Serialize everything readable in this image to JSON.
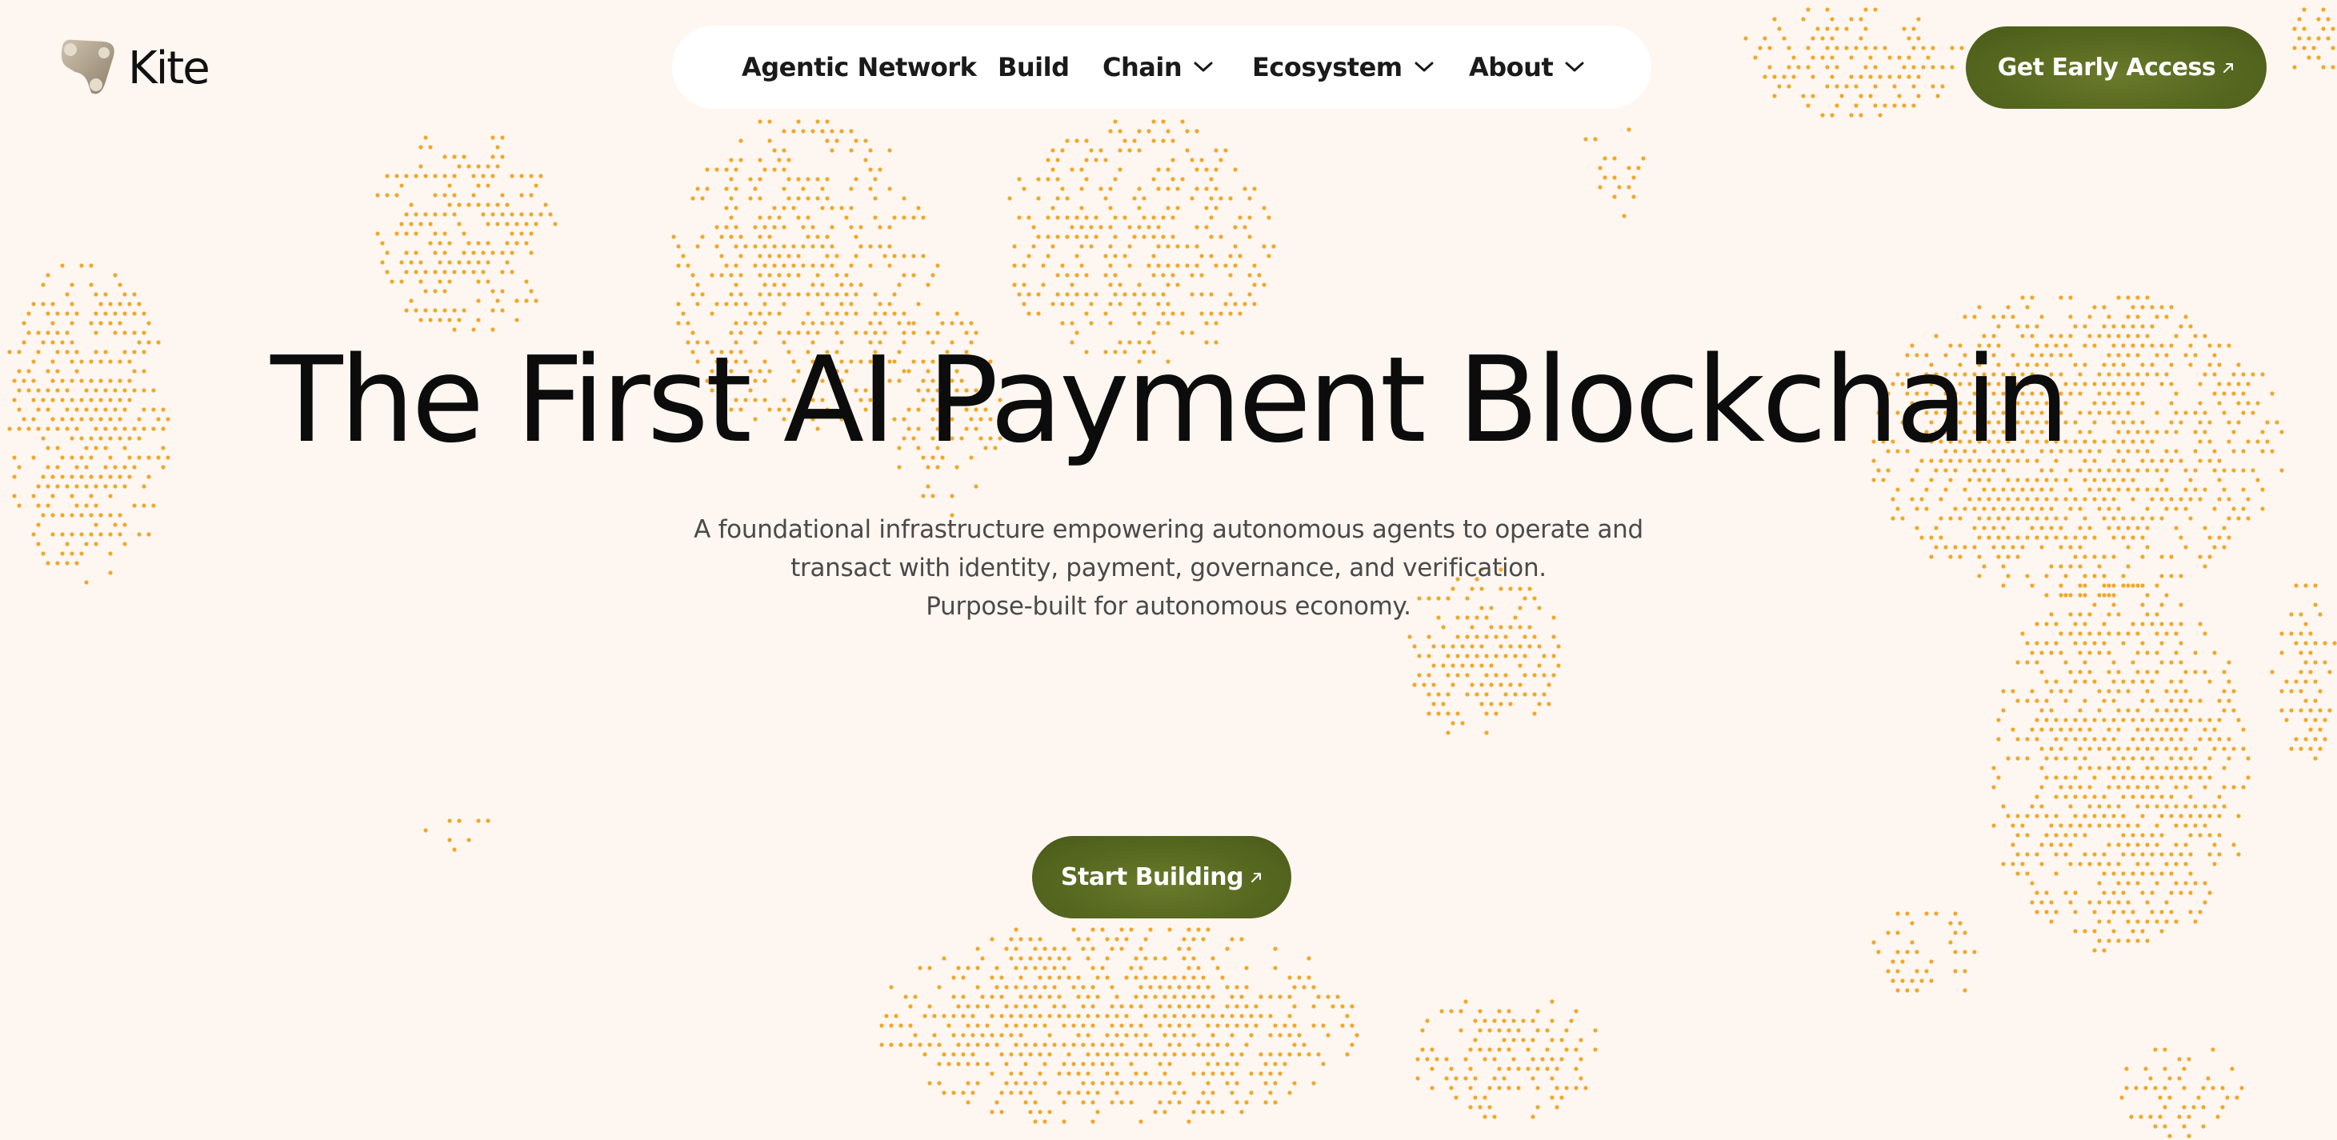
{
  "brand": {
    "name": "Kite",
    "logo_icon": "kite-logo-icon"
  },
  "nav": {
    "items": [
      {
        "label": "Agentic Network",
        "has_dropdown": false
      },
      {
        "label": "Build",
        "has_dropdown": false
      },
      {
        "label": "Chain",
        "has_dropdown": true
      },
      {
        "label": "Ecosystem",
        "has_dropdown": true
      },
      {
        "label": "About",
        "has_dropdown": true
      }
    ],
    "dropdown_icon": "chevron-down-icon"
  },
  "header_cta": {
    "label": "Get Early Access",
    "icon": "arrow-up-right-icon"
  },
  "hero": {
    "title": "The First AI Payment Blockchain",
    "subtitle_lines": [
      "A foundational infrastructure empowering autonomous agents to operate and",
      "transact with identity, payment, governance, and verification.",
      "Purpose-built for autonomous economy."
    ],
    "cta": {
      "label": "Start Building",
      "icon": "arrow-up-right-icon"
    }
  },
  "colors": {
    "background": "#fdf6f1",
    "accent_green": "#56681f",
    "dot_orange": "#f0a82a",
    "text_dark": "#111111",
    "text_muted": "#4a4a4a",
    "nav_bg": "#ffffff"
  }
}
